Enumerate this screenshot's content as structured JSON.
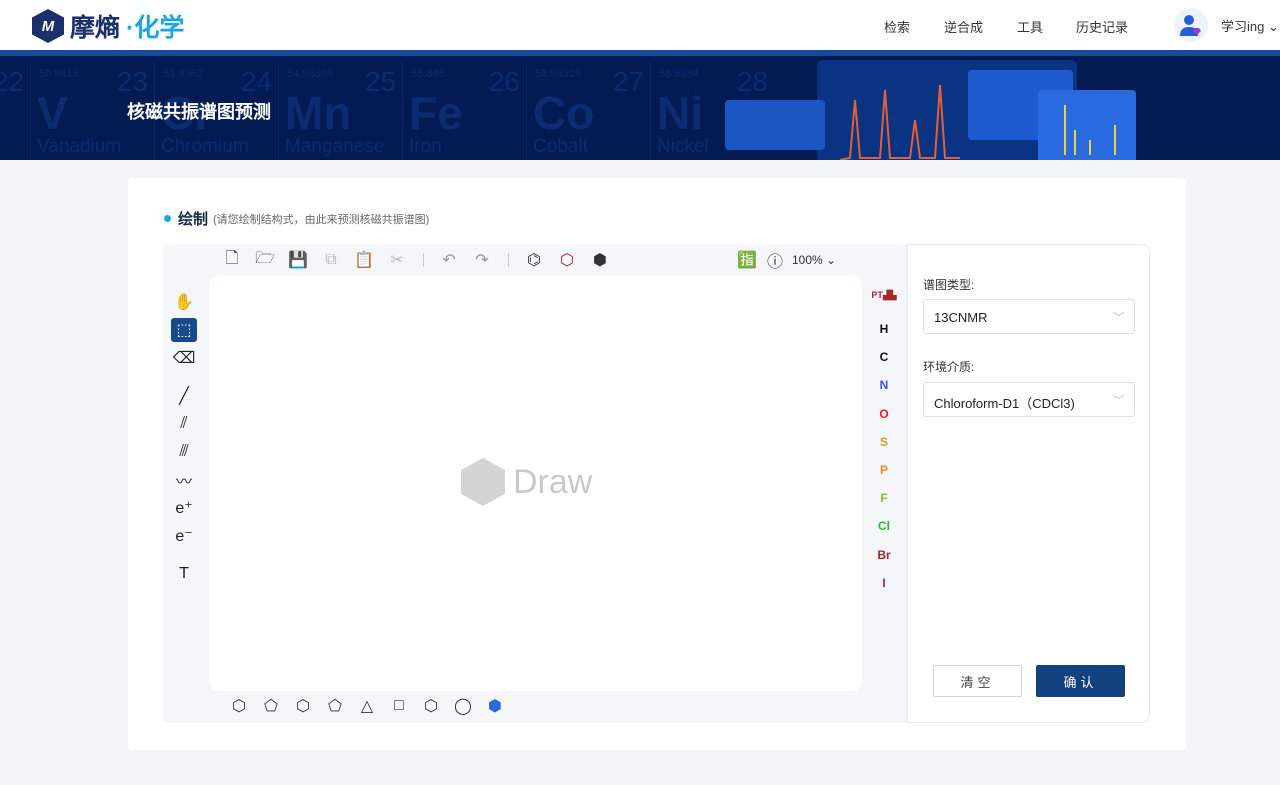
{
  "header": {
    "logo_mark": "M",
    "logo_text_1": "摩熵",
    "logo_text_2": "·化学",
    "nav": [
      "检索",
      "逆合成",
      "工具",
      "历史记录"
    ],
    "user": "学习ing",
    "user_chevron": "⌄"
  },
  "banner": {
    "title": "核磁共振谱图预测",
    "elements": [
      {
        "num": "22",
        "sym": "",
        "mass": "",
        "name": ""
      },
      {
        "num": "23",
        "sym": "V",
        "mass": "50.9415",
        "name": "Vanadium"
      },
      {
        "num": "24",
        "sym": "Cr",
        "mass": "51.9962",
        "name": "Chromium"
      },
      {
        "num": "25",
        "sym": "Mn",
        "mass": "54.93804",
        "name": "Manganese"
      },
      {
        "num": "26",
        "sym": "Fe",
        "mass": "55.845",
        "name": "Iron"
      },
      {
        "num": "27",
        "sym": "Co",
        "mass": "58.93319",
        "name": "Cobalt"
      },
      {
        "num": "28",
        "sym": "Ni",
        "mass": "58.6934",
        "name": "Nickel"
      }
    ]
  },
  "section": {
    "title": "绘制",
    "hint": "(请您绘制结构式，由此来预测核磁共振谱图)"
  },
  "editor": {
    "zoom": "100%",
    "watermark": "Draw",
    "atoms": [
      {
        "label": "H",
        "color": "#111111"
      },
      {
        "label": "C",
        "color": "#111111"
      },
      {
        "label": "N",
        "color": "#3a4ff5"
      },
      {
        "label": "O",
        "color": "#f01c1c"
      },
      {
        "label": "S",
        "color": "#d4a020"
      },
      {
        "label": "P",
        "color": "#f58a1c"
      },
      {
        "label": "F",
        "color": "#7cc23a"
      },
      {
        "label": "Cl",
        "color": "#22c022"
      },
      {
        "label": "Br",
        "color": "#a82828"
      },
      {
        "label": "I",
        "color": "#9a1a9a"
      }
    ],
    "periodic_label": "PT"
  },
  "panel": {
    "spectrum_label": "谱图类型:",
    "spectrum_value": "13CNMR",
    "solvent_label": "环境介质:",
    "solvent_value": "Chloroform-D1（CDCl3)",
    "clear": "清空",
    "confirm": "确认"
  }
}
